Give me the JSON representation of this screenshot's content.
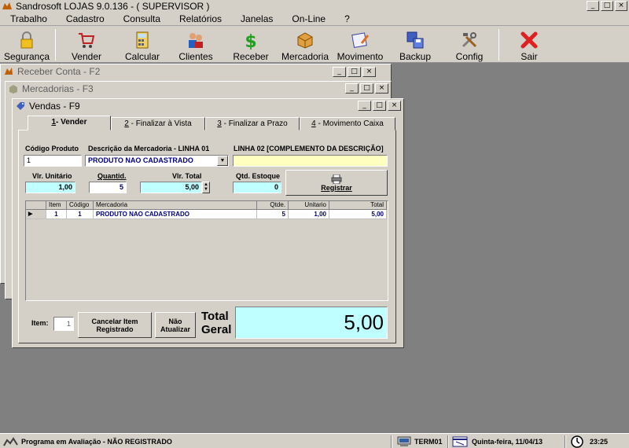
{
  "app": {
    "title": "Sandrosoft LOJAS 9.0.136  - ( SUPERVISOR )",
    "min": "_",
    "max": "□",
    "close": "×"
  },
  "menu": [
    "Trabalho",
    "Cadastro",
    "Consulta",
    "Relatórios",
    "Janelas",
    "On-Line",
    "?"
  ],
  "toolbar": [
    {
      "label": "Segurança",
      "icon": "lock-icon"
    },
    {
      "label": "Vender",
      "icon": "cart-icon"
    },
    {
      "label": "Calcular",
      "icon": "calculator-icon"
    },
    {
      "label": "Clientes",
      "icon": "people-icon"
    },
    {
      "label": "Receber",
      "icon": "dollar-icon"
    },
    {
      "label": "Mercadoria",
      "icon": "box-icon"
    },
    {
      "label": "Movimento",
      "icon": "ledger-icon"
    },
    {
      "label": "Backup",
      "icon": "floppy-icon"
    },
    {
      "label": "Config",
      "icon": "tools-icon"
    },
    {
      "label": "Sair",
      "icon": "exit-x-icon"
    }
  ],
  "windows": {
    "receber": {
      "title": "Receber Conta - F2"
    },
    "mercadorias": {
      "title": "Mercadorias - F3"
    },
    "vendas": {
      "title": "Vendas - F9"
    }
  },
  "tabs": [
    {
      "num": "1",
      "label": "- Vender"
    },
    {
      "num": "2",
      "label": " - Finalizar à Vista"
    },
    {
      "num": "3",
      "label": " - Finalizar a Prazo"
    },
    {
      "num": "4",
      "label": " - Movimento Caixa"
    }
  ],
  "form": {
    "codigo_label": "Código Produto",
    "codigo_value": "1",
    "descricao_label": "Descrição da Mercadoria - LINHA 01",
    "descricao_value": "PRODUTO NAO CADASTRADO",
    "linha2_label": "LINHA 02  [COMPLEMENTO DA DESCRIÇÃO]",
    "linha2_value": "",
    "vlr_unitario_label": "Vlr. Unitário",
    "vlr_unitario_value": "1,00",
    "quantid_label": "Quantid.",
    "quantid_value": "5",
    "vlr_total_label": "Vlr. Total",
    "vlr_total_value": "5,00",
    "qtd_estoque_label": "Qtd. Estoque",
    "qtd_estoque_value": "0",
    "registrar_label": "Registrar"
  },
  "grid": {
    "columns": [
      "Item",
      "Código",
      "Mercadoria",
      "Qtde.",
      "Unitario",
      "Total"
    ],
    "rows": [
      {
        "item": "1",
        "codigo": "1",
        "mercadoria": "PRODUTO NAO CADASTRADO",
        "qtde": "5",
        "unitario": "1,00",
        "total": "5,00"
      }
    ]
  },
  "footer": {
    "item_label": "Item:",
    "item_value": "1",
    "cancelar_line1": "Cancelar Item",
    "cancelar_line2": "Registrado",
    "nao_line1": "Não",
    "nao_line2": "Atualizar",
    "total_line1": "Total",
    "total_line2": "Geral",
    "total_value": "5,00"
  },
  "status": {
    "program": "Programa em Avaliação - NÃO REGISTRADO",
    "terminal": "TERM01",
    "date": "Quinta-feira, 11/04/13",
    "time": "23:25"
  },
  "colors": {
    "cyan_field": "#c0ffff",
    "yellow_field": "#ffffc0",
    "total_box": "#c0ffff",
    "data_text": "#00007f"
  }
}
